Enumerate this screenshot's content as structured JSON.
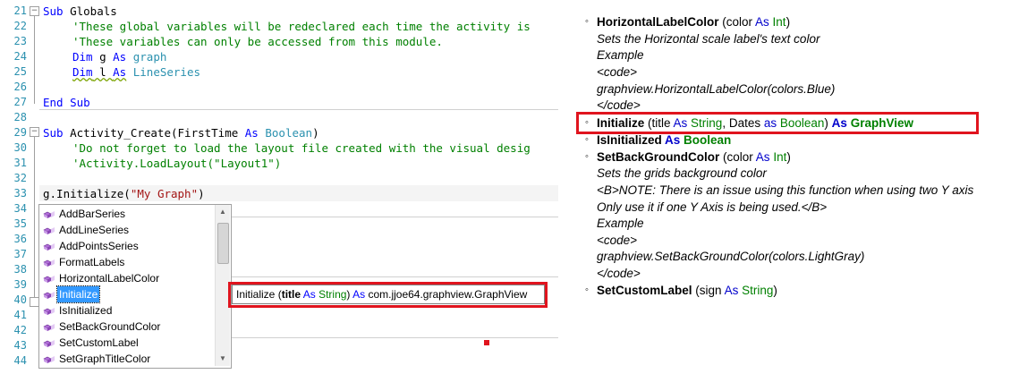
{
  "editor": {
    "line_numbers": [
      "21",
      "22",
      "23",
      "24",
      "25",
      "26",
      "27",
      "28",
      "29",
      "30",
      "31",
      "32",
      "33",
      "34",
      "35",
      "36",
      "37",
      "38",
      "39",
      "40",
      "41",
      "42",
      "43",
      "44"
    ],
    "lines": {
      "l21": {
        "kw": "Sub",
        "rest": " Globals"
      },
      "l22": "'These global variables will be redeclared each time the activity is",
      "l23": "'These variables can only be accessed from this module.",
      "l24": {
        "kw": "Dim",
        "mid": " g ",
        "kw2": "As",
        "ty": " graph"
      },
      "l25": {
        "kw": "Dim",
        "mid": " l ",
        "kw2": "As",
        "ty": " LineSeries"
      },
      "l27": {
        "kw": "End Sub"
      },
      "l29": {
        "kw": "Sub",
        "mid": " Activity_Create(FirstTime ",
        "kw2": "As",
        "ty": " Boolean",
        "tail": ")"
      },
      "l30": "'Do not forget to load the layout file created with the visual desig",
      "l31": "'Activity.LoadLayout(\"Layout1\")",
      "l33": {
        "pre": "g.Initialize(",
        "str": "\"My Graph\"",
        "tail": ")"
      }
    }
  },
  "autocomplete": {
    "items": [
      "AddBarSeries",
      "AddLineSeries",
      "AddPointsSeries",
      "FormatLabels",
      "HorizontalLabelColor",
      "Initialize",
      "IsInitialized",
      "SetBackGroundColor",
      "SetCustomLabel",
      "SetGraphTitleColor"
    ],
    "selected_index": 5,
    "scroll_up_icon": "triangle-up",
    "scroll_down_icon": "triangle-down",
    "item_icon": "method-cube-icon"
  },
  "tooltip": {
    "name": "Initialize",
    "open": " (",
    "param": "title",
    "as": " As ",
    "type": "String",
    "close": ")",
    "as2": " As ",
    "returns": "com.jjoe64.graphview.GraphView"
  },
  "doc": {
    "hlc_name": "HorizontalLabelColor",
    "hlc_open": " (color ",
    "hlc_as": "As",
    "hlc_type": " Int",
    "hlc_close": ")",
    "hlc_desc": "Sets the Horizontal scale label's text color",
    "hlc_example": "Example",
    "hlc_code_open": "<code>",
    "hlc_code": "graphview.HorizontalLabelColor(colors.Blue)",
    "hlc_code_close": "</code>",
    "init_name": "Initialize",
    "init_p1": " (title ",
    "init_as1": "As",
    "init_t1": " String",
    "init_p2": ", Dates ",
    "init_as2": "as",
    "init_t2": " Boolean",
    "init_p3": ") ",
    "init_as3": "As",
    "init_ret": " GraphView",
    "isinit_name": "IsInitialized",
    "isinit_as": " As",
    "isinit_type": " Boolean",
    "sbg_name": "SetBackGroundColor",
    "sbg_open": " (color ",
    "sbg_as": "As",
    "sbg_type": " Int",
    "sbg_close": ")",
    "sbg_desc": "Sets the grids background color",
    "sbg_note1": "<B>NOTE: There is an issue using this function when using two Y axis",
    "sbg_note2": "Only use it if one Y Axis is being used.</B>",
    "sbg_example": "Example",
    "sbg_code_open": "<code>",
    "sbg_code": "graphview.SetBackGroundColor(colors.LightGray)",
    "sbg_code_close": "</code>",
    "scl_name": "SetCustomLabel",
    "scl_open": " (sign ",
    "scl_as": "As",
    "scl_type": " String",
    "scl_close": ")",
    "bullet": "◦"
  },
  "colors": {
    "highlight_red": "#e0141e",
    "keyword_blue": "#0000ff",
    "comment_green": "#008000",
    "type_teal": "#2b91af",
    "string_red": "#a31515",
    "selection_blue": "#3399ff"
  }
}
